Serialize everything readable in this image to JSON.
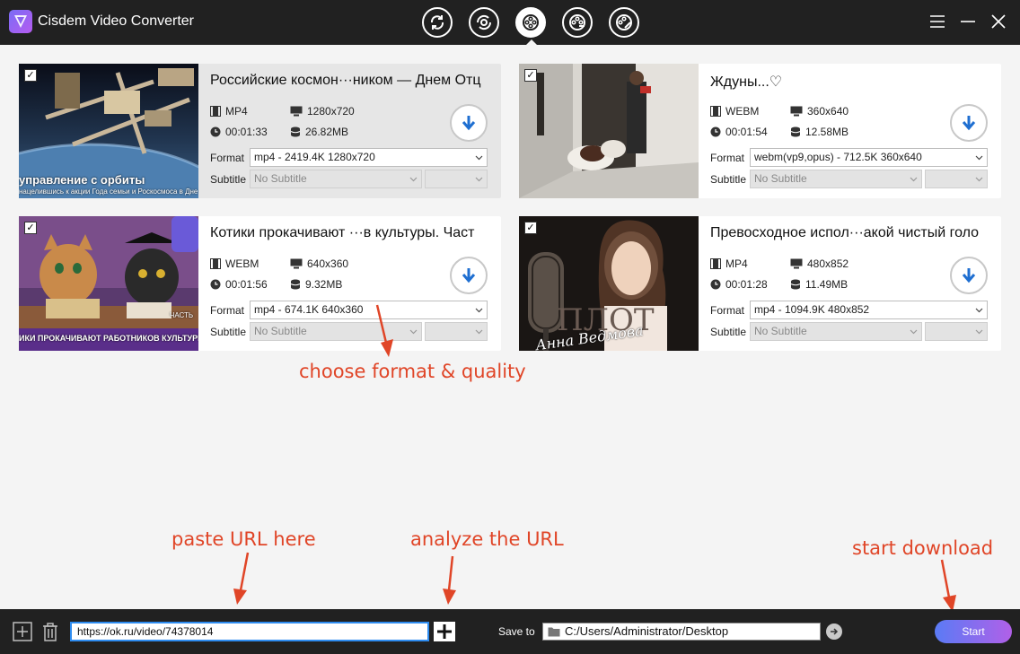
{
  "window": {
    "title": "Cisdem Video Converter",
    "mode_buttons": [
      "convert-icon",
      "rip-icon",
      "download-icon",
      "burn-icon",
      "edit-icon"
    ],
    "active_mode": 2
  },
  "videos": [
    {
      "title": "Российские космон···ником — Днем Отц",
      "thumb_caption": "управление с орбиты",
      "thumb_subcaption": "нацелившись к акции Года семьи и Роскосмоса в Дне",
      "container": "MP4",
      "resolution": "1280x720",
      "duration": "00:01:33",
      "size": "26.82MB",
      "format_label": "Format",
      "format_value": "mp4 - 2419.4K 1280x720",
      "subtitle_label": "Subtitle",
      "subtitle_value": "No Subtitle",
      "checked": true
    },
    {
      "title": "Ждуны...♡",
      "thumb_caption": "",
      "thumb_subcaption": "",
      "container": "WEBM",
      "resolution": "360x640",
      "duration": "00:01:54",
      "size": "12.58MB",
      "format_label": "Format",
      "format_value": "webm(vp9,opus) - 712.5K 360x640",
      "subtitle_label": "Subtitle",
      "subtitle_value": "No Subtitle",
      "checked": true
    },
    {
      "title": "Котики прокачивают ···в культуры. Част",
      "thumb_caption": "ИКИ ПРОКАЧИВАЮТ РАБОТНИКОВ КУЛЬТУРЫ",
      "thumb_subcaption": "ЧАСТЬ",
      "container": "WEBM",
      "resolution": "640x360",
      "duration": "00:01:56",
      "size": "9.32MB",
      "format_label": "Format",
      "format_value": "mp4 - 674.1K 640x360",
      "subtitle_label": "Subtitle",
      "subtitle_value": "No Subtitle",
      "checked": true
    },
    {
      "title": "Превосходное испол···акой чистый голо",
      "thumb_caption": "ПЛОТ",
      "thumb_subcaption": "Анна Ведмова",
      "container": "MP4",
      "resolution": "480x852",
      "duration": "00:01:28",
      "size": "11.49MB",
      "format_label": "Format",
      "format_value": "mp4 - 1094.9K 480x852",
      "subtitle_label": "Subtitle",
      "subtitle_value": "No Subtitle",
      "checked": true
    }
  ],
  "annotations": {
    "format": "choose format & quality",
    "paste": "paste URL here",
    "analyze": "analyze the URL",
    "start": "start download"
  },
  "bottom": {
    "url_value": "https://ok.ru/video/74378014",
    "save_to_label": "Save to",
    "save_path": "C:/Users/Administrator/Desktop",
    "start_label": "Start"
  },
  "colors": {
    "titlebar": "#212121",
    "accent_blue": "#1f6fd1",
    "annotation_red": "#e04527",
    "start_gradient": [
      "#5a7bf5",
      "#b160e8"
    ]
  }
}
